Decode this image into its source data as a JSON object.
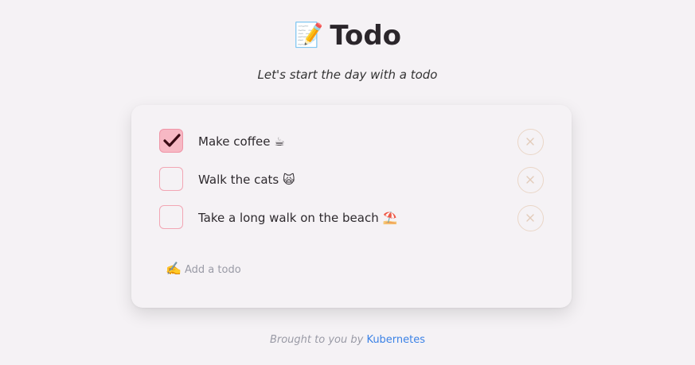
{
  "header": {
    "title_emoji": "📝",
    "title": "Todo",
    "subtitle": "Let's start the day with a todo"
  },
  "todos": [
    {
      "text": "Make coffee ☕",
      "checked": true
    },
    {
      "text": "Walk the cats 🙀",
      "checked": false
    },
    {
      "text": "Take a long walk on the beach ⛱️",
      "checked": false
    }
  ],
  "add_todo": {
    "icon": "✍️",
    "placeholder": "Add a todo",
    "value": ""
  },
  "footer": {
    "prefix": "Brought to you by",
    "link_text": "Kubernetes"
  },
  "colors": {
    "background": "#f5f2f5",
    "checkbox_border": "#f2a6b4",
    "checkbox_checked_fill": "#f7b8c4",
    "delete_button_border": "#ead6c7",
    "link": "#3b82e6",
    "muted_text": "#9a9ba6"
  },
  "icons": {
    "checkmark": "checkmark-icon",
    "delete": "close-icon"
  }
}
